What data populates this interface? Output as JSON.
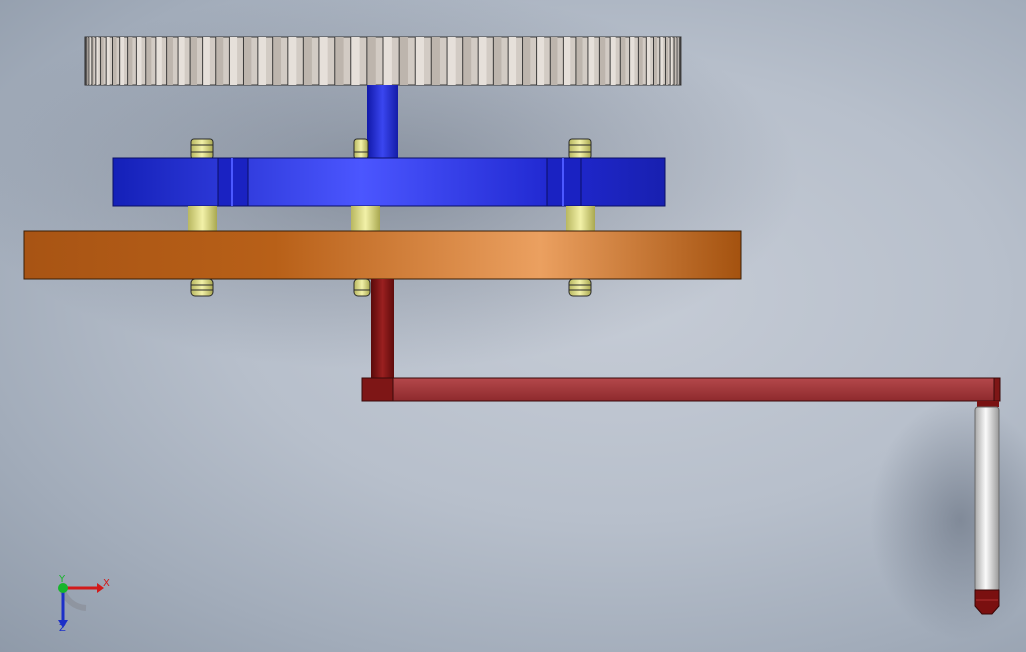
{
  "viewport": {
    "background_top": "#9aa4b3",
    "background_mid": "#c3c9d3"
  },
  "parts": {
    "gear": {
      "color_light": "#d8d2cc",
      "color_dark": "#6e6863",
      "tooth_count": 58
    },
    "blue_carrier": {
      "color": "#2530e0",
      "highlight": "#5c66ff"
    },
    "blue_shaft": {
      "color": "#1c28c8"
    },
    "orange_plate": {
      "color": "#c86a1e",
      "highlight": "#f0a060"
    },
    "spacer_posts": {
      "color": "#e3e28e"
    },
    "crank_shaft": {
      "color": "#7a1212"
    },
    "crank_arm": {
      "color": "#9c2f33"
    },
    "handle": {
      "color": "#e6e6e6",
      "cap_color": "#6e0e10"
    }
  },
  "triad": {
    "x_label": "X",
    "y_label": "Y",
    "z_label": "Z",
    "x_color": "#d21a1a",
    "y_color": "#17b52b",
    "z_color": "#1c30c8"
  }
}
